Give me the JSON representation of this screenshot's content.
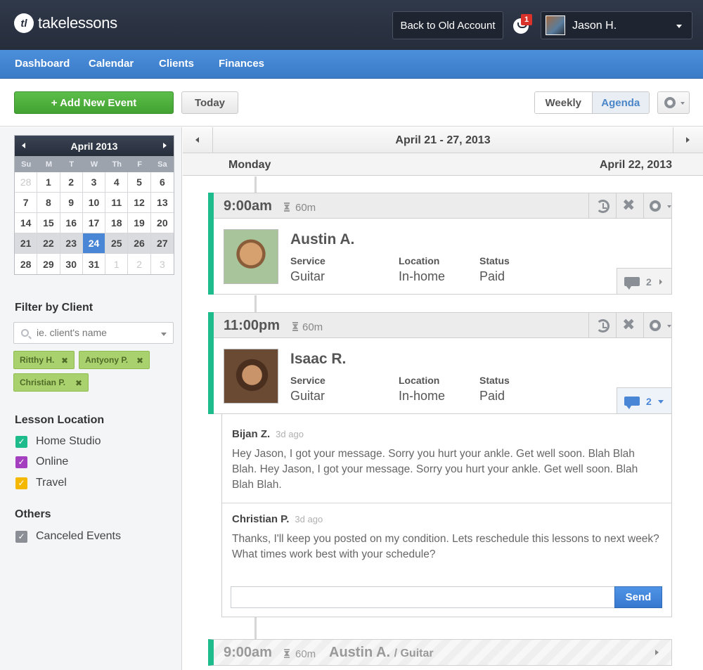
{
  "app": {
    "brand": "takelessons",
    "brand_mark": "tl",
    "back_button": "Back to Old Account",
    "notification_count": "1",
    "user_name": "Jason H."
  },
  "nav": [
    "Dashboard",
    "Calendar",
    "Clients",
    "Finances"
  ],
  "toolbar": {
    "add_event": "+ Add New Event",
    "today": "Today",
    "view_weekly": "Weekly",
    "view_agenda": "Agenda",
    "active_view": "Agenda"
  },
  "mini_calendar": {
    "month": "April 2013",
    "weekdays": [
      "Su",
      "M",
      "T",
      "W",
      "Th",
      "F",
      "Sa"
    ],
    "days": [
      "28",
      "1",
      "2",
      "3",
      "4",
      "5",
      "6",
      "7",
      "8",
      "9",
      "10",
      "11",
      "12",
      "13",
      "14",
      "15",
      "16",
      "17",
      "18",
      "19",
      "20",
      "21",
      "22",
      "23",
      "24",
      "25",
      "26",
      "27",
      "28",
      "29",
      "30",
      "31",
      "1",
      "2",
      "3"
    ],
    "selected": "24"
  },
  "sidebar": {
    "filter_heading": "Filter by Client",
    "filter_placeholder": "ie. client's name",
    "filter_tags": [
      "Ritthy H.",
      "Antyony P.",
      "Christian P."
    ],
    "location_heading": "Lesson Location",
    "locations": [
      {
        "label": "Home Studio",
        "color": "#1ebc8c"
      },
      {
        "label": "Online",
        "color": "#a43fbf"
      },
      {
        "label": "Travel",
        "color": "#f4b800"
      }
    ],
    "others_heading": "Others",
    "others": [
      {
        "label": "Canceled Events",
        "color": "#8b8f95"
      }
    ]
  },
  "agenda": {
    "week_range": "April 21 - 27, 2013",
    "day_name": "Monday",
    "day_date": "April 22, 2013",
    "events": [
      {
        "time": "9:00am",
        "duration": "60m",
        "name": "Austin A.",
        "service_label": "Service",
        "service": "Guitar",
        "location_label": "Location",
        "location": "In-home",
        "status_label": "Status",
        "status": "Paid",
        "comments": "2"
      },
      {
        "time": "11:00pm",
        "duration": "60m",
        "name": "Isaac R.",
        "service_label": "Service",
        "service": "Guitar",
        "location_label": "Location",
        "location": "In-home",
        "status_label": "Status",
        "status": "Paid",
        "comments": "2"
      }
    ],
    "thread": [
      {
        "author": "Bijan Z.",
        "time": "3d ago",
        "text": "Hey Jason, I got your message. Sorry you hurt your ankle. Get well soon. Blah Blah Blah. Hey Jason, I got your message. Sorry you hurt your ankle. Get well soon. Blah Blah Blah."
      },
      {
        "author": "Christian P.",
        "time": "3d ago",
        "text": "Thanks, I'll keep you posted on my condition. Lets reschedule this lessons to next week? What times work best with your schedule?"
      }
    ],
    "reply_value": "",
    "send": "Send",
    "collapsed_event": {
      "time": "9:00am",
      "duration": "60m",
      "name": "Austin A.",
      "service": "/ Guitar"
    }
  }
}
